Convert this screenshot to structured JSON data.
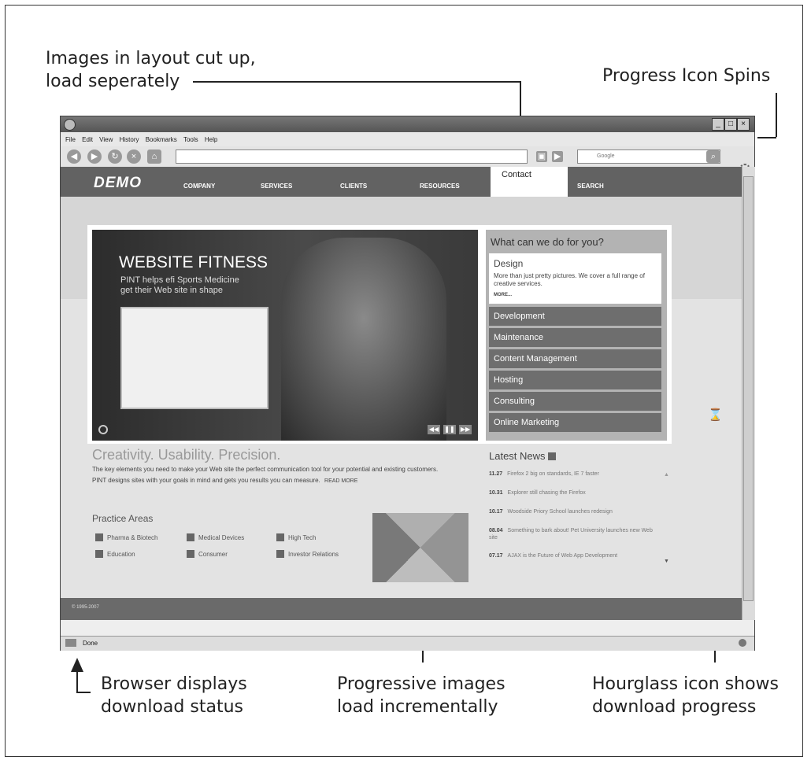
{
  "callouts": {
    "top_left_line1": "Images in layout cut up,",
    "top_left_line2": "load seperately",
    "top_right": "Progress Icon Spins",
    "bottom_left_line1": "Browser displays",
    "bottom_left_line2": "download status",
    "bottom_center_line1": "Progressive images",
    "bottom_center_line2": "load incrementally",
    "bottom_right_line1": "Hourglass icon shows",
    "bottom_right_line2": "download progress"
  },
  "browser": {
    "menu": [
      "File",
      "Edit",
      "View",
      "History",
      "Bookmarks",
      "Tools",
      "Help"
    ],
    "search_placeholder": "Google",
    "status": "Done"
  },
  "site": {
    "logo": "DEMO",
    "nav": [
      "COMPANY",
      "SERVICES",
      "CLIENTS",
      "RESOURCES",
      "Contact",
      "SEARCH"
    ],
    "hero": {
      "title": "WEBSITE FITNESS",
      "subtitle_line1": "PINT helps efi Sports Medicine",
      "subtitle_line2": "get their Web site in shape"
    },
    "services_heading": "What can we do for you?",
    "design": {
      "title": "Design",
      "desc": "More than just pretty pictures. We cover a full range of creative services.",
      "more": "MORE..."
    },
    "services": [
      "Development",
      "Maintenance",
      "Content Management",
      "Hosting",
      "Consulting",
      "Online Marketing"
    ],
    "tagline": "Creativity. Usability. Precision.",
    "intro": "The key elements you need to make your Web site the perfect communication tool for your potential and existing customers. PINT designs sites with your goals in mind and gets you results you can measure.",
    "read_more": "READ MORE",
    "practice_heading": "Practice Areas",
    "practice_areas": [
      "Pharma & Biotech",
      "Medical Devices",
      "High Tech",
      "Education",
      "Consumer",
      "Investor Relations"
    ],
    "news_heading": "Latest News",
    "news": [
      {
        "date": "11.27",
        "title": "Firefox 2 big on standards, IE 7 faster"
      },
      {
        "date": "10.31",
        "title": "Explorer still chasing the Firefox"
      },
      {
        "date": "10.17",
        "title": "Woodside Priory School launches redesign"
      },
      {
        "date": "08.04",
        "title": "Something to bark about! Pet University launches new Web site"
      },
      {
        "date": "07.17",
        "title": "AJAX is the Future of Web App Development"
      }
    ],
    "copyright": "© 1995-2007"
  }
}
